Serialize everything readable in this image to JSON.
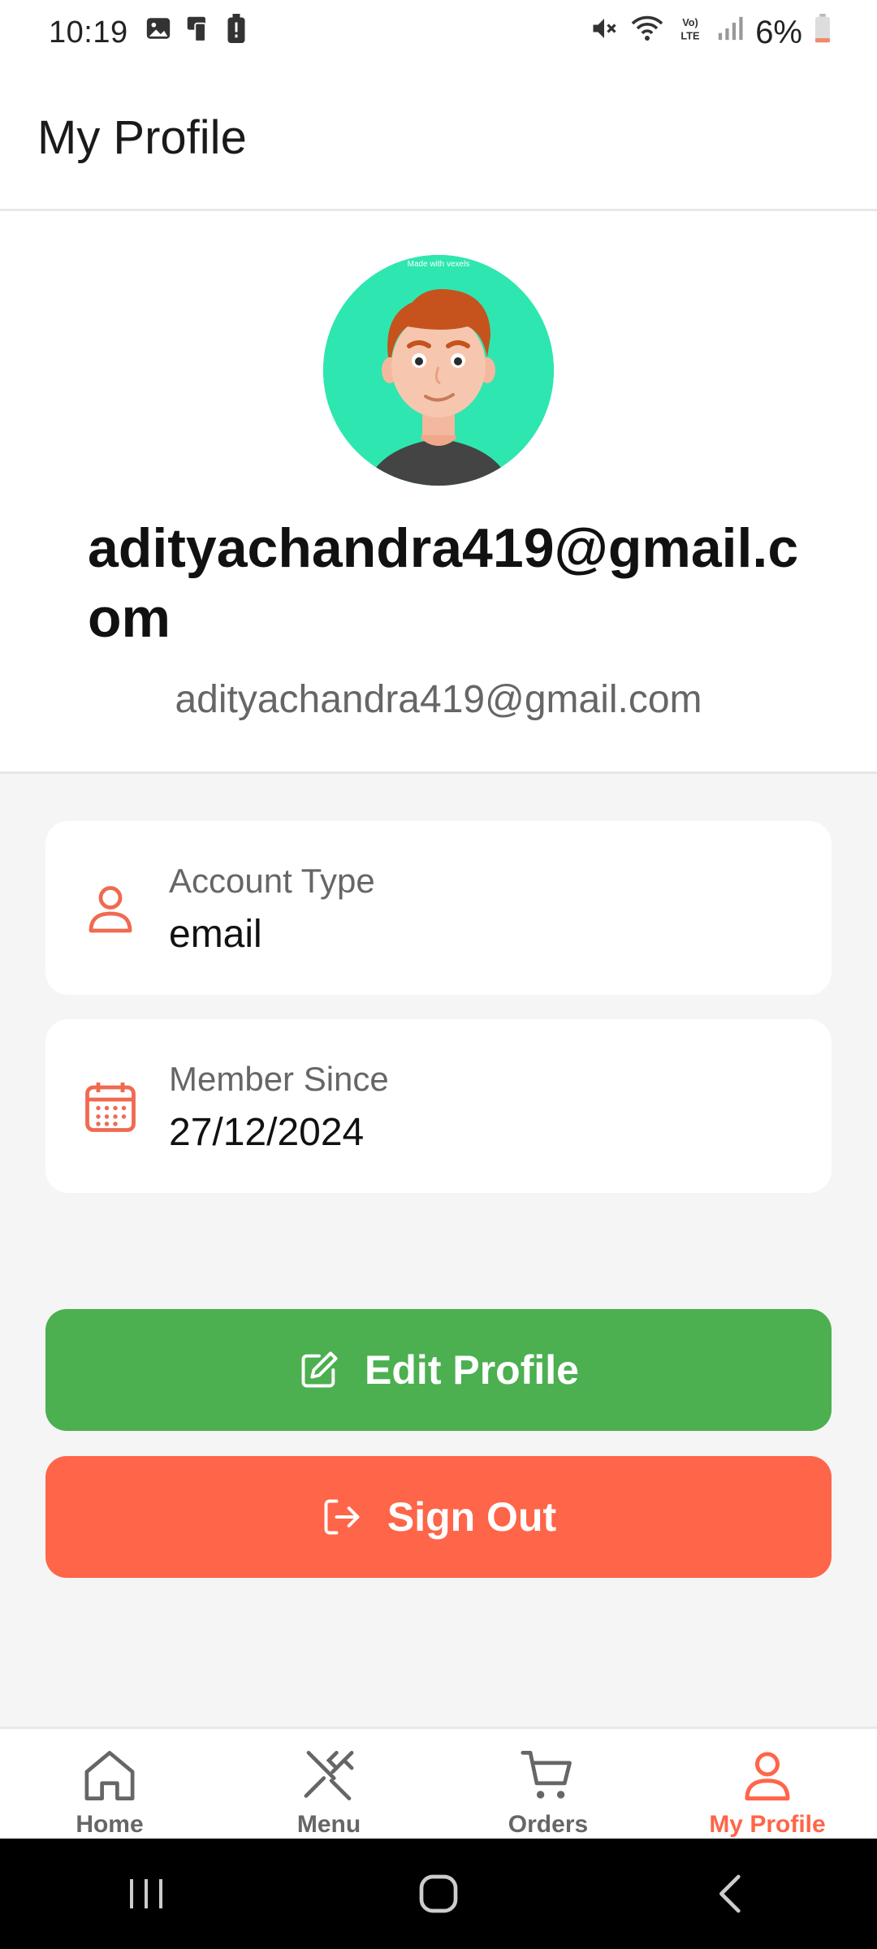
{
  "status_bar": {
    "time": "10:19",
    "battery_percent": "6%",
    "left_icons": [
      "gallery-icon",
      "device-icon",
      "battery-alert-icon"
    ],
    "right_icons": [
      "mute-icon",
      "wifi-icon",
      "volte-icon",
      "signal-icon",
      "battery-icon"
    ]
  },
  "header": {
    "title": "My Profile"
  },
  "profile": {
    "display_name": "adityachandra419@gmail.com",
    "email": "adityachandra419@gmail.com",
    "avatar_watermark": "Made with vexels",
    "avatar_bg_color": "#2ee6b0"
  },
  "info_cards": [
    {
      "label": "Account Type",
      "value": "email",
      "icon": "user-icon"
    },
    {
      "label": "Member Since",
      "value": "27/12/2024",
      "icon": "calendar-icon"
    }
  ],
  "actions": {
    "edit_profile": {
      "label": "Edit Profile",
      "icon": "edit-icon",
      "color": "#4caf50"
    },
    "sign_out": {
      "label": "Sign Out",
      "icon": "logout-icon",
      "color": "#ff6549"
    }
  },
  "bottom_nav": {
    "items": [
      {
        "label": "Home",
        "icon": "home-icon",
        "active": false
      },
      {
        "label": "Menu",
        "icon": "utensils-icon",
        "active": false
      },
      {
        "label": "Orders",
        "icon": "cart-icon",
        "active": false
      },
      {
        "label": "My Profile",
        "icon": "user-icon",
        "active": true
      }
    ],
    "active_color": "#ff6549",
    "inactive_color": "#666666"
  },
  "system_nav": [
    "recents-button",
    "home-button",
    "back-button"
  ]
}
